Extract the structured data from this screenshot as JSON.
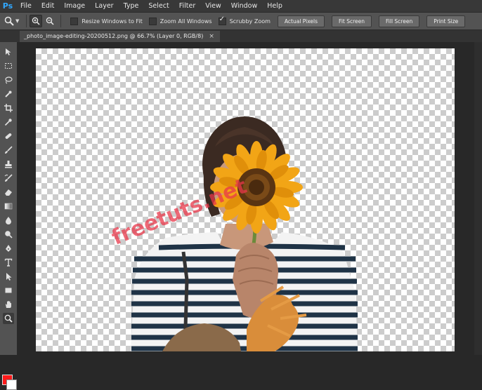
{
  "app": {
    "logo": "Ps",
    "accent": "#31a8ff"
  },
  "menu": [
    "File",
    "Edit",
    "Image",
    "Layer",
    "Type",
    "Select",
    "Filter",
    "View",
    "Window",
    "Help"
  ],
  "options": {
    "tool_icon": "zoom-icon",
    "checkboxes": [
      {
        "label": "Resize Windows to Fit",
        "checked": false
      },
      {
        "label": "Zoom All Windows",
        "checked": false
      },
      {
        "label": "Scrubby Zoom",
        "checked": true
      }
    ],
    "buttons": [
      "Actual Pixels",
      "Fit Screen",
      "Fill Screen",
      "Print Size"
    ]
  },
  "document": {
    "tab_title": "_photo_image-editing-20200512.png @ 66.7% (Layer 0, RGB/8)",
    "close": "×"
  },
  "tools": [
    "move-icon",
    "marquee-icon",
    "lasso-icon",
    "quick-select-icon",
    "crop-icon",
    "eyedropper-icon",
    "healing-brush-icon",
    "brush-icon",
    "clone-stamp-icon",
    "history-brush-icon",
    "eraser-icon",
    "gradient-icon",
    "blur-icon",
    "dodge-icon",
    "pen-icon",
    "type-icon",
    "path-select-icon",
    "rectangle-icon",
    "hand-icon",
    "zoom-icon"
  ],
  "colors": {
    "foreground": "#ff1a1a",
    "background": "#ffffff"
  },
  "watermark": "freetuts.net"
}
